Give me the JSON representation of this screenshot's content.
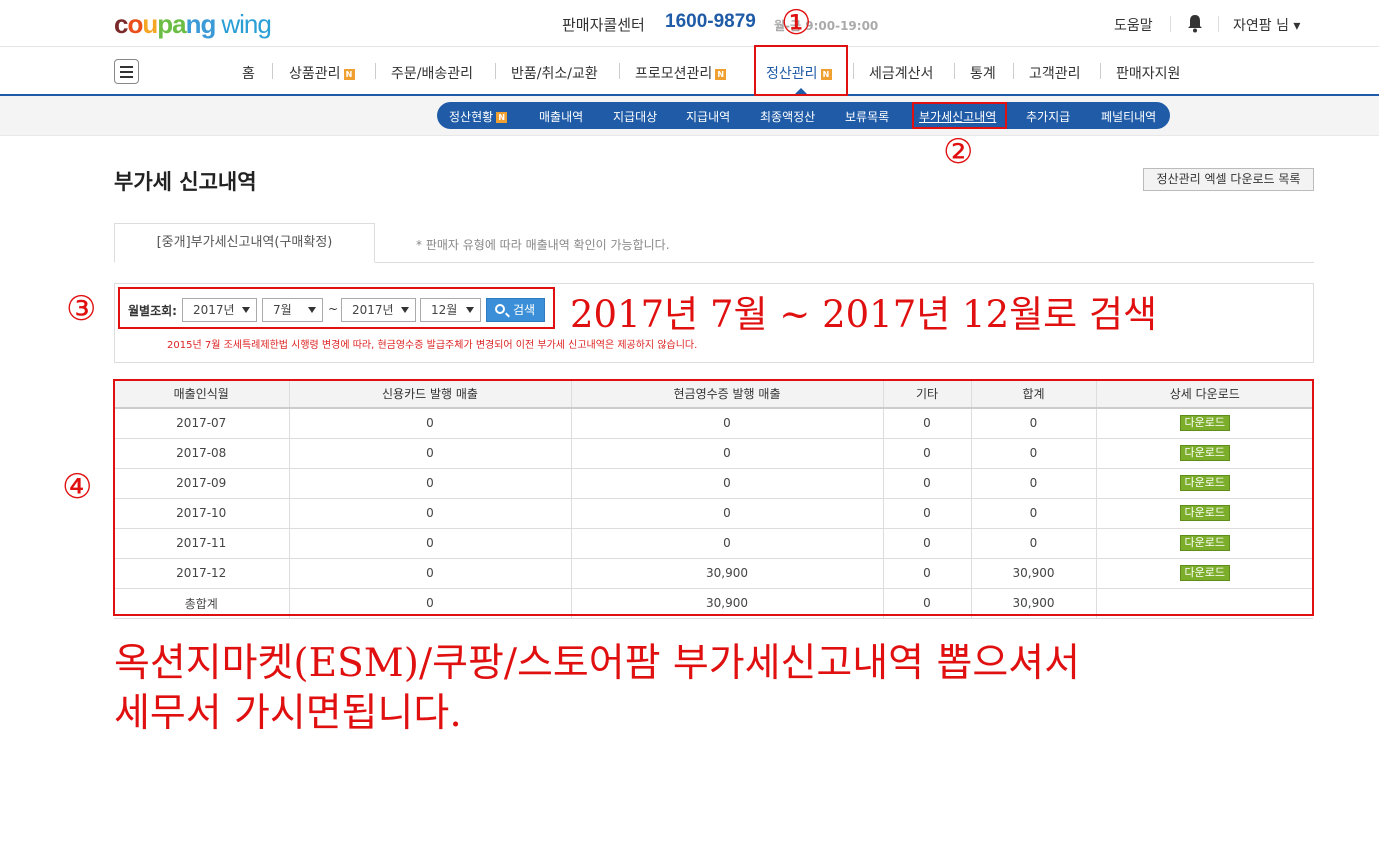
{
  "header": {
    "logo": {
      "c": "c",
      "o": "o",
      "u": "u",
      "pa": "pa",
      "ng": "ng",
      "wing": "wing"
    },
    "center_label": "판매자콜센터",
    "center_phone": "1600-9879",
    "center_hours": "월-금 9:00-19:00",
    "help": "도움말",
    "user": "자연팜 님 ▾"
  },
  "nav": {
    "items": [
      {
        "label": "홈"
      },
      {
        "label": "상품관리",
        "badge": "N"
      },
      {
        "label": "주문/배송관리"
      },
      {
        "label": "반품/취소/교환"
      },
      {
        "label": "프로모션관리",
        "badge": "N"
      },
      {
        "label": "정산관리",
        "badge": "N",
        "active": true
      },
      {
        "label": "세금계산서"
      },
      {
        "label": "통계"
      },
      {
        "label": "고객관리"
      },
      {
        "label": "판매자지원"
      }
    ]
  },
  "subnav": {
    "items": [
      {
        "label": "정산현황",
        "badge": "N"
      },
      {
        "label": "매출내역"
      },
      {
        "label": "지급대상"
      },
      {
        "label": "지급내역"
      },
      {
        "label": "최종액정산"
      },
      {
        "label": "보류목록"
      },
      {
        "label": "부가세신고내역",
        "active": true
      },
      {
        "label": "추가지급"
      },
      {
        "label": "페널티내역"
      }
    ]
  },
  "page": {
    "title": "부가세 신고내역",
    "excel_button": "정산관리 엑셀 다운로드 목록",
    "tab": "[중개]부가세신고내역(구매확정)",
    "tab_note": "* 판매자 유형에 따라 매출내역 확인이 가능합니다."
  },
  "search": {
    "label": "월별조회:",
    "from_year": "2017년",
    "from_month": "7월",
    "tilde": "~",
    "to_year": "2017년",
    "to_month": "12월",
    "button": "검색",
    "notice": "2015년 7월 조세특례제한법 시행령 변경에 따라, 현금영수증 발급주체가 변경되어 이전 부가세 신고내역은 제공하지 않습니다."
  },
  "table": {
    "headers": [
      "매출인식월",
      "신용카드 발행 매출",
      "현금영수증 발행 매출",
      "기타",
      "합계",
      "상세 다운로드"
    ],
    "rows": [
      [
        "2017-07",
        "0",
        "0",
        "0",
        "0",
        "다운로드"
      ],
      [
        "2017-08",
        "0",
        "0",
        "0",
        "0",
        "다운로드"
      ],
      [
        "2017-09",
        "0",
        "0",
        "0",
        "0",
        "다운로드"
      ],
      [
        "2017-10",
        "0",
        "0",
        "0",
        "0",
        "다운로드"
      ],
      [
        "2017-11",
        "0",
        "0",
        "0",
        "0",
        "다운로드"
      ],
      [
        "2017-12",
        "0",
        "30,900",
        "0",
        "30,900",
        "다운로드"
      ]
    ],
    "total": [
      "총합계",
      "0",
      "30,900",
      "0",
      "30,900",
      ""
    ]
  },
  "annotations": {
    "n1": "①",
    "n2": "②",
    "n3": "③",
    "n4": "④",
    "search_caption": "2017년 7월 ~ 2017년 12월로 검색",
    "footer_line1": "옥션지마켓(ESM)/쿠팡/스토어팜 부가세신고내역 뽑으셔서",
    "footer_line2": "세무서 가시면됩니다.",
    "color": "#e01010"
  },
  "colors": {
    "brand_blue": "#1f5ba7",
    "badge_orange": "#f0a030",
    "download_green": "#7cae2c",
    "search_blue": "#3a8fd8"
  }
}
